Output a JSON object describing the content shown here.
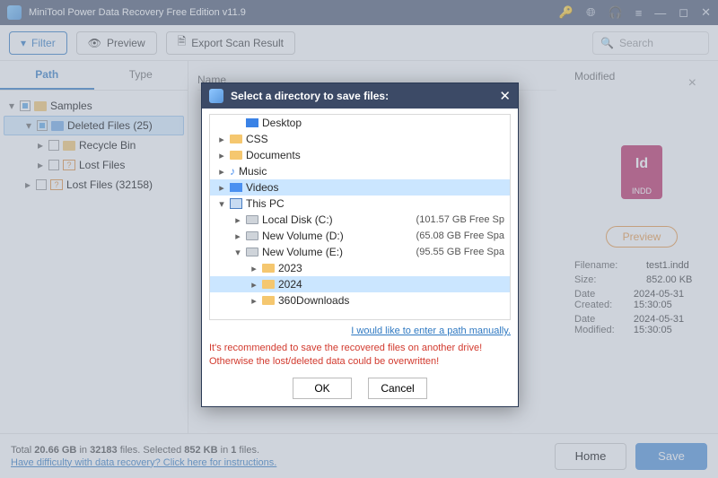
{
  "titlebar": {
    "title": "MiniTool Power Data Recovery Free Edition v11.9"
  },
  "toolbar": {
    "filter": "Filter",
    "preview": "Preview",
    "export": "Export Scan Result",
    "search_placeholder": "Search"
  },
  "tabs": {
    "path": "Path",
    "type": "Type"
  },
  "tree": {
    "samples": "Samples",
    "deleted": "Deleted Files (25)",
    "recycle": "Recycle Bin",
    "lost1": "Lost Files",
    "lost2": "Lost Files (32158)"
  },
  "header_cols": {
    "name": "Name",
    "modified": "Modified"
  },
  "preview": {
    "button": "Preview",
    "icon_label": "INDD",
    "meta": [
      {
        "k": "Filename:",
        "v": "test1.indd"
      },
      {
        "k": "Size:",
        "v": "852.00 KB"
      },
      {
        "k": "Date Created:",
        "v": "2024-05-31 15:30:05"
      },
      {
        "k": "Date Modified:",
        "v": "2024-05-31 15:30:05"
      }
    ]
  },
  "footer": {
    "summary_a": "Total ",
    "summary_size": "20.66 GB",
    "summary_b": " in ",
    "summary_files": "32183",
    "summary_c": " files.   Selected ",
    "summary_sel_size": "852 KB",
    "summary_d": " in ",
    "summary_sel_files": "1",
    "summary_e": " files.",
    "help": "Have difficulty with data recovery? Click here for instructions.",
    "home": "Home",
    "save": "Save"
  },
  "modal": {
    "title": "Select a directory to save files:",
    "rows": [
      {
        "indent": 1,
        "caret": "",
        "icon": "desk",
        "label": "Desktop",
        "free": ""
      },
      {
        "indent": 0,
        "caret": "▸",
        "icon": "folder",
        "label": "CSS",
        "free": ""
      },
      {
        "indent": 0,
        "caret": "▸",
        "icon": "folder",
        "label": "Documents",
        "free": ""
      },
      {
        "indent": 0,
        "caret": "▸",
        "icon": "music",
        "label": "Music",
        "free": ""
      },
      {
        "indent": 0,
        "caret": "▸",
        "icon": "vid",
        "label": "Videos",
        "free": "",
        "sel": true
      },
      {
        "indent": 0,
        "caret": "▾",
        "icon": "pc",
        "label": "This PC",
        "free": ""
      },
      {
        "indent": 1,
        "caret": "▸",
        "icon": "drive",
        "label": "Local Disk (C:)",
        "free": "(101.57 GB Free Sp"
      },
      {
        "indent": 1,
        "caret": "▸",
        "icon": "drive",
        "label": "New Volume (D:)",
        "free": "(65.08 GB Free Spa"
      },
      {
        "indent": 1,
        "caret": "▾",
        "icon": "drive",
        "label": "New Volume (E:)",
        "free": "(95.55 GB Free Spa"
      },
      {
        "indent": 2,
        "caret": "▸",
        "icon": "folder",
        "label": "2023",
        "free": ""
      },
      {
        "indent": 2,
        "caret": "▸",
        "icon": "folder",
        "label": "2024",
        "free": "",
        "sel": true
      },
      {
        "indent": 2,
        "caret": "▸",
        "icon": "folder",
        "label": "360Downloads",
        "free": ""
      }
    ],
    "manual": "I would like to enter a path manually.",
    "warning": "It's recommended to save the recovered files on another drive! Otherwise the lost/deleted data could be overwritten!",
    "ok": "OK",
    "cancel": "Cancel"
  }
}
